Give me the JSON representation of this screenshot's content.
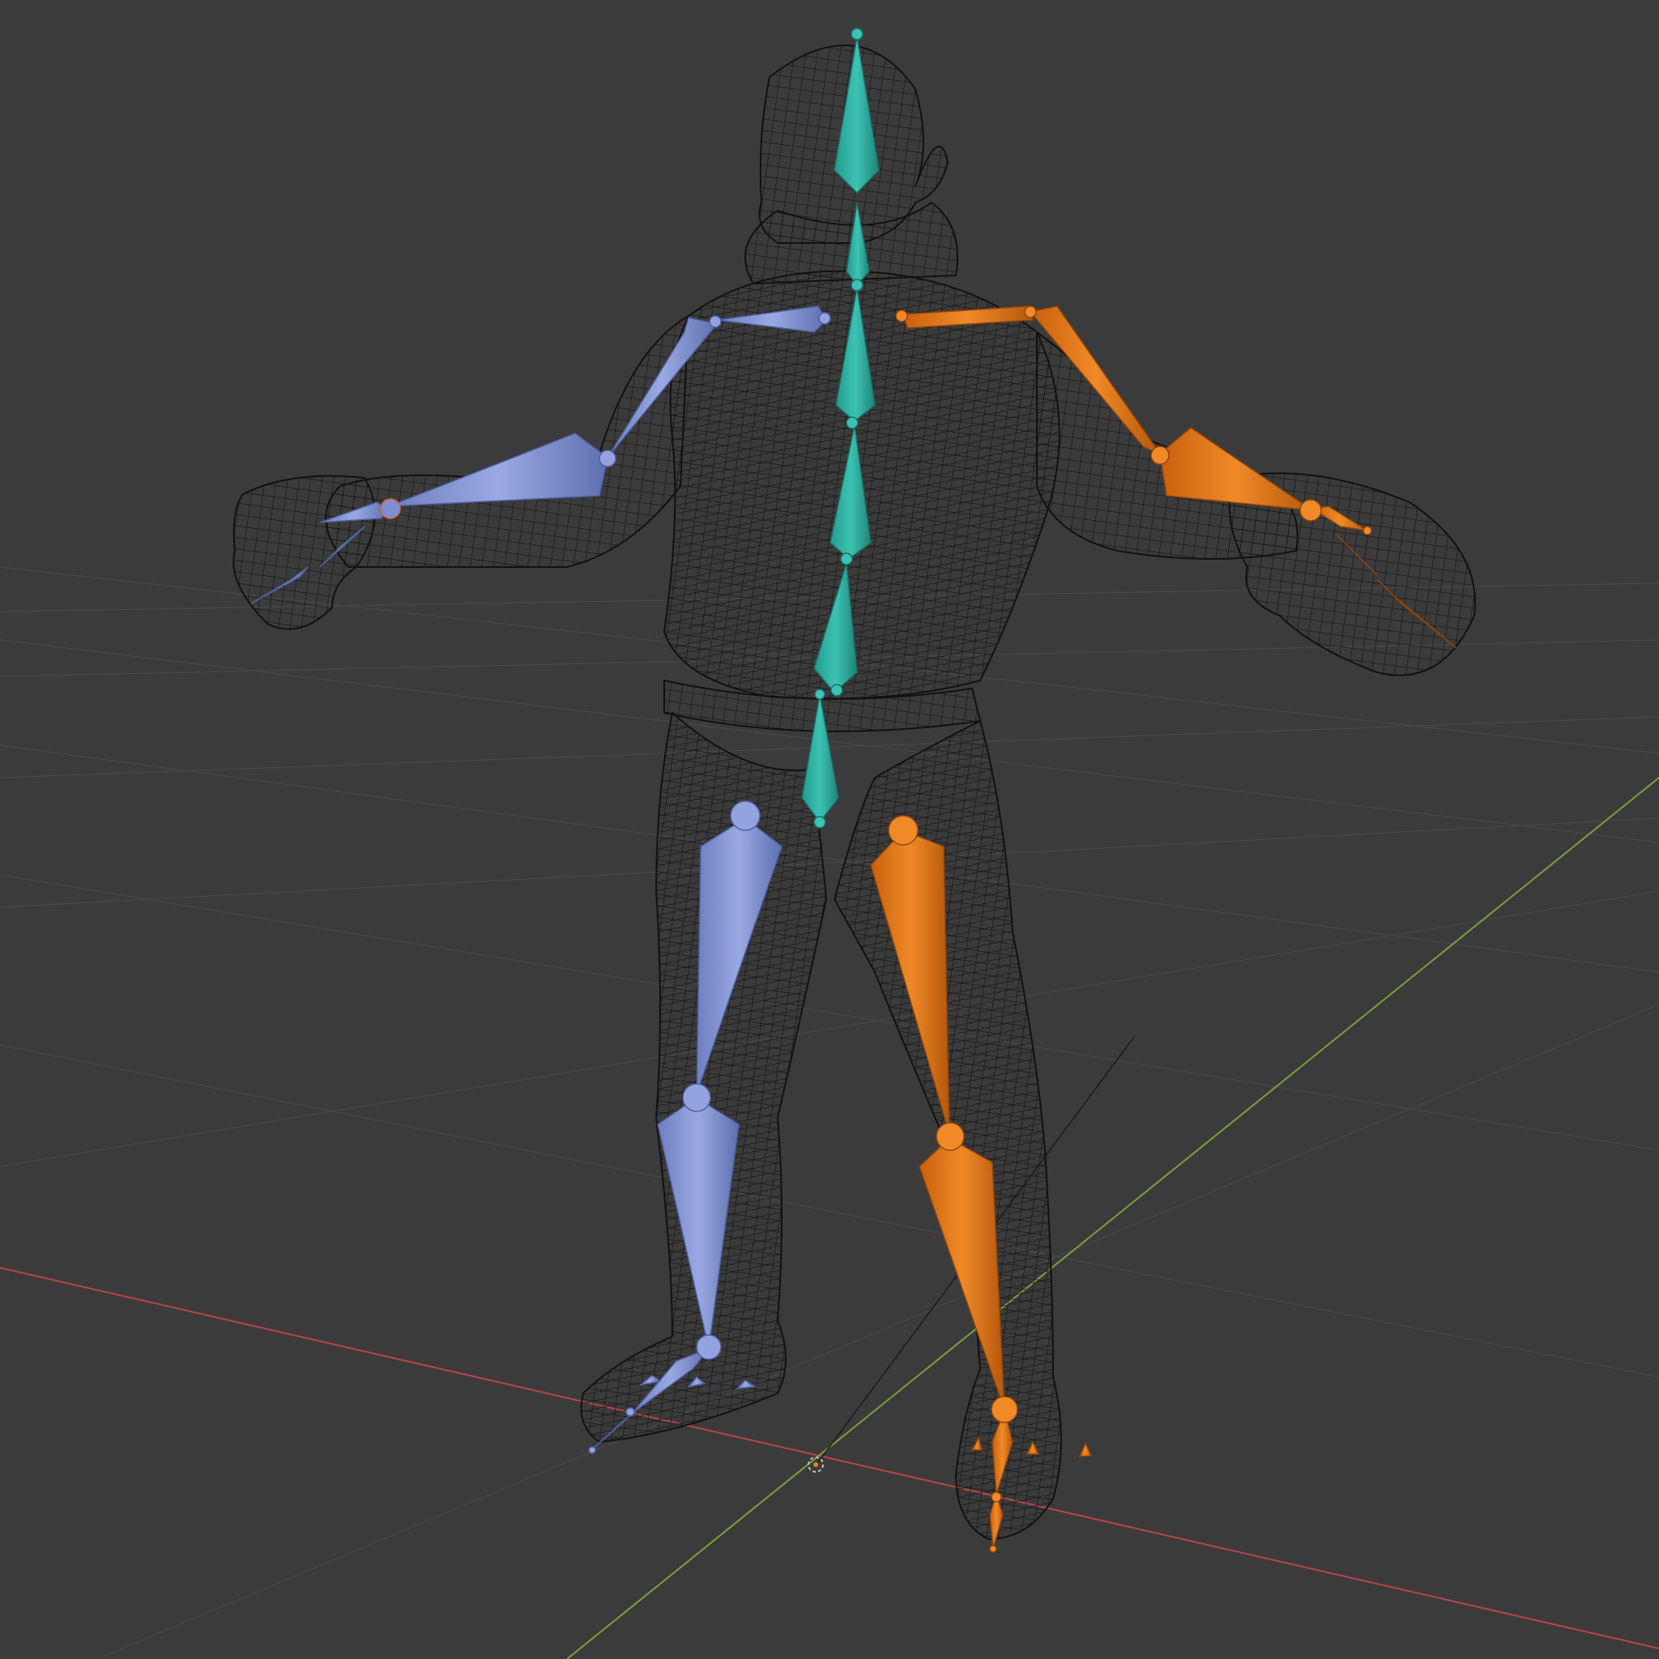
{
  "viewport": {
    "background": "#3b3b3b",
    "grid_color": "#4a4a4a",
    "x_axis_color": "#b8444c",
    "y_axis_color": "#7ba13a",
    "mesh_color": "#111111"
  },
  "bone_colors": {
    "center": "#2aa89a",
    "left_side": "#7d8fd0",
    "right_side": "#e87b1c"
  },
  "icons": {
    "origin": "3d-cursor-icon"
  }
}
